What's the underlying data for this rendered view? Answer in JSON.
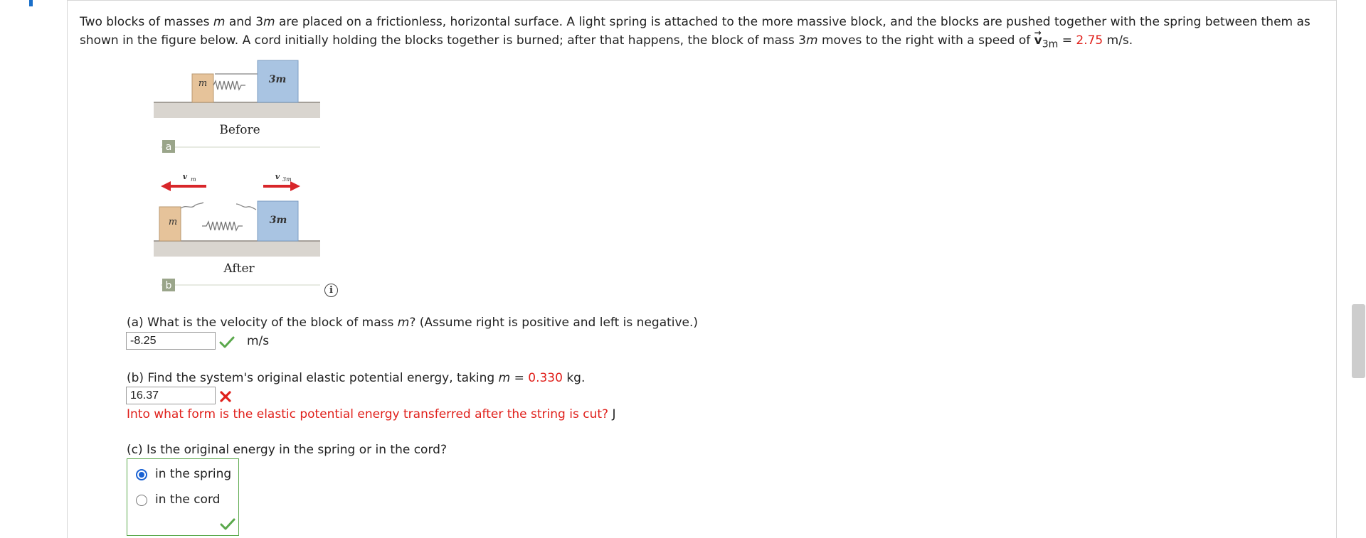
{
  "problem": {
    "text_part1": "Two blocks of masses ",
    "m1": "m",
    "text_part2": " and 3",
    "m2": "m",
    "text_part3": " are placed on a frictionless, horizontal surface. A light spring is attached to the more massive block, and the blocks are pushed together with the spring between them as shown in the figure below. A cord initially holding the blocks together is burned; after that happens, the block of mass 3",
    "m3": "m",
    "text_part4": " moves to the right with a speed of ",
    "vec_symbol": "v",
    "vec_sub": "3m",
    "eq": " = ",
    "speed": "2.75",
    "speed_unit": " m/s."
  },
  "figure": {
    "label_m_top": "m",
    "label_3m_top": "3m",
    "label_before": "Before",
    "badge_a": "a",
    "label_vm": "v",
    "label_vm_sub": "m",
    "label_v3m": "v",
    "label_v3m_sub": "3m",
    "label_m_bottom": "m",
    "label_3m_bottom": "3m",
    "label_after": "After",
    "badge_b": "b",
    "info_icon": "i",
    "colors": {
      "block_m": "#e6c39a",
      "block_3m": "#a9c4e2",
      "ground": "#d9d5cf",
      "arrow": "#d8262a",
      "badge": "#9aa58a"
    }
  },
  "part_a": {
    "question_pre": "(a) What is the velocity of the block of mass ",
    "question_var": "m",
    "question_post": "? (Assume right is positive and left is negative.)",
    "answer": "-8.25",
    "unit": "m/s",
    "status": "correct"
  },
  "part_b": {
    "question_pre": "(b) Find the system's original elastic potential energy, taking ",
    "question_var": "m",
    "question_eq": " = ",
    "mass_value": "0.330",
    "question_post": " kg.",
    "answer": "16.37",
    "status": "incorrect",
    "hint": "Into what form is the elastic potential energy transferred after the string is cut?",
    "hint_unit": " J"
  },
  "part_c": {
    "question": "(c) Is the original energy in the spring or in the cord?",
    "options": [
      "in the spring",
      "in the cord"
    ],
    "selected": "in the spring",
    "status": "correct"
  },
  "colors": {
    "accent_red": "#e0201b",
    "correct_green": "#5aa84b",
    "incorrect_red": "#e0201b",
    "radio_blue": "#1a62d3"
  }
}
